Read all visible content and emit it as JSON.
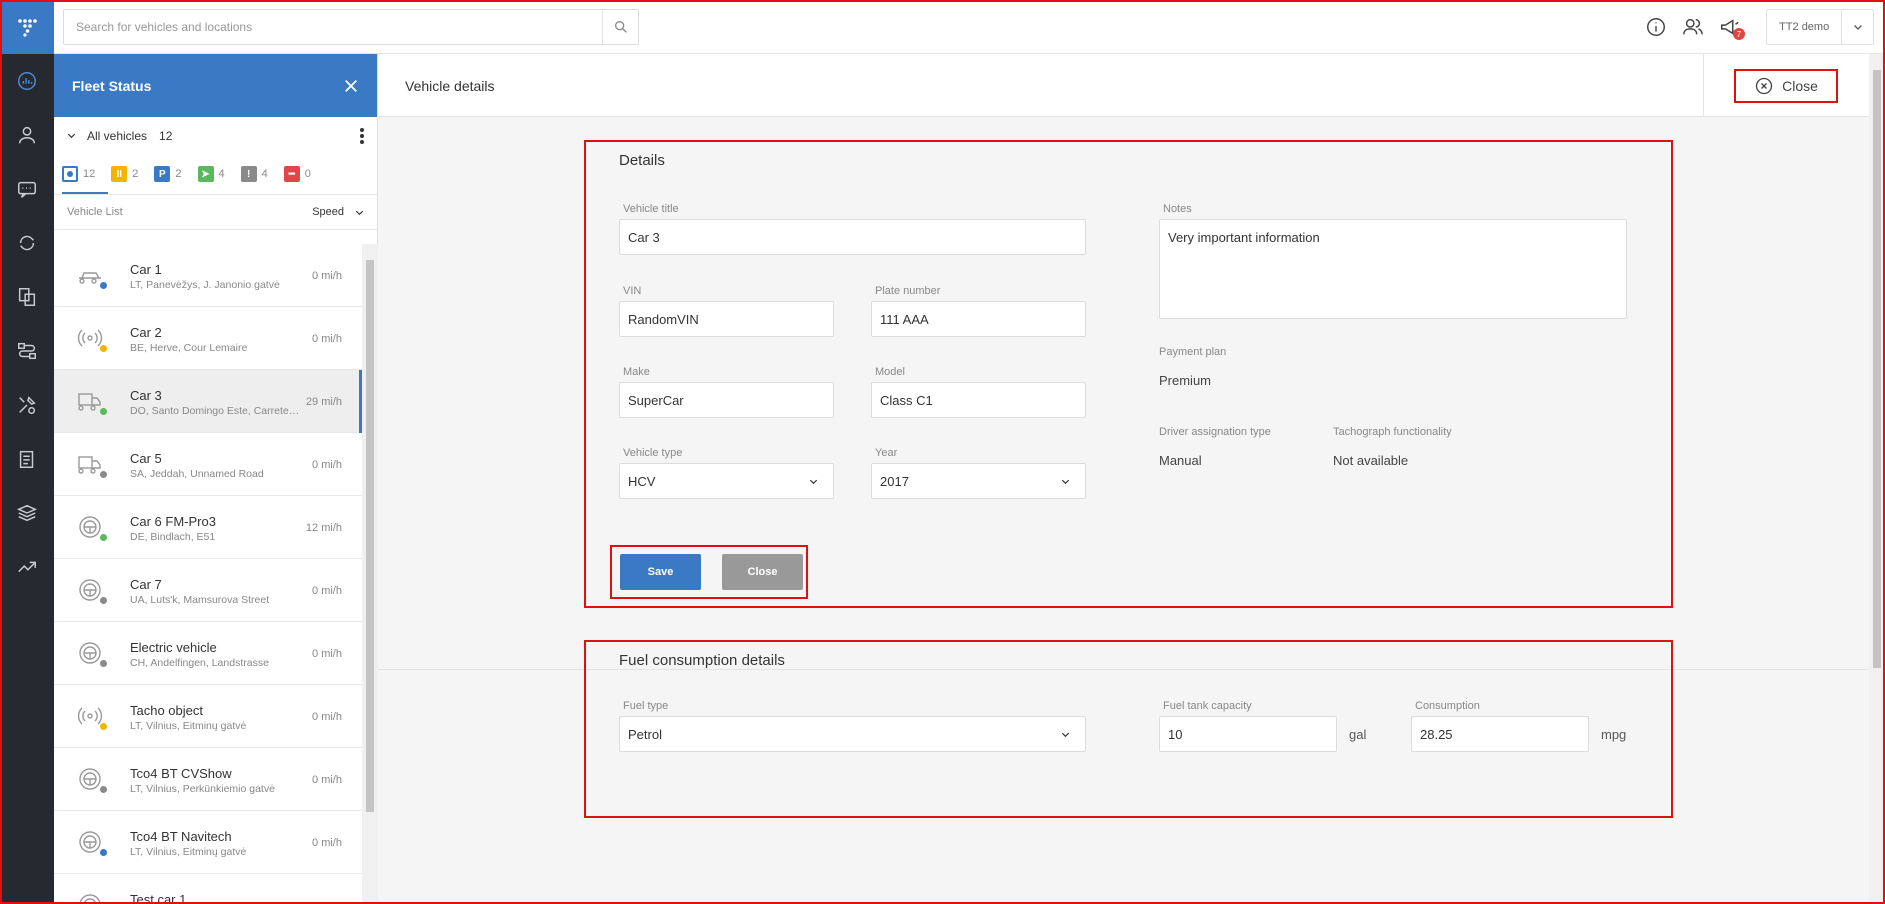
{
  "search": {
    "placeholder": "Search for vehicles and locations"
  },
  "header": {
    "account_name": "TT2 demo",
    "notification_count": "7"
  },
  "rail": {
    "items": [
      "dashboard",
      "drivers",
      "messages",
      "routes",
      "reports",
      "tasks",
      "maintenance",
      "documents",
      "layers",
      "analytics"
    ]
  },
  "fleet": {
    "title": "Fleet Status",
    "group_label": "All vehicles",
    "group_count": "12",
    "status_filters": [
      {
        "icon": "all-status",
        "count": "12",
        "color": "#3a79c4"
      },
      {
        "icon": "paused-status",
        "count": "2",
        "color": "#f5b400"
      },
      {
        "icon": "parked-status",
        "count": "2",
        "color": "#3a79c4"
      },
      {
        "icon": "moving-status",
        "count": "4",
        "color": "#5cb85c"
      },
      {
        "icon": "alert-status",
        "count": "4",
        "color": "#8a8a8a"
      },
      {
        "icon": "stopped-status",
        "count": "0",
        "color": "#e04646"
      }
    ],
    "list_label": "Vehicle List",
    "sort_label": "Speed",
    "vehicles": [
      {
        "name": "Car 1",
        "address": "LT, Panevėžys, J. Janonio gatvė",
        "speed": "0 mi/h",
        "icon": "car",
        "dot": "#3a79c4"
      },
      {
        "name": "Car 2",
        "address": "BE, Herve, Cour Lemaire",
        "speed": "0 mi/h",
        "icon": "signal",
        "dot": "#f5b400"
      },
      {
        "name": "Car 3",
        "address": "DO, Santo Domingo Este, Carretera Mella",
        "speed": "29 mi/h",
        "icon": "truck",
        "dot": "#5cb85c"
      },
      {
        "name": "Car 5",
        "address": "SA, Jeddah, Unnamed Road",
        "speed": "0 mi/h",
        "icon": "truck",
        "dot": "#8a8a8a"
      },
      {
        "name": "Car 6 FM-Pro3",
        "address": "DE, Bindlach, E51",
        "speed": "12 mi/h",
        "icon": "wheel",
        "dot": "#5cb85c"
      },
      {
        "name": "Car 7",
        "address": "UA, Luts'k, Mamsurova Street",
        "speed": "0 mi/h",
        "icon": "wheel",
        "dot": "#8a8a8a"
      },
      {
        "name": "Electric vehicle",
        "address": "CH, Andelfingen, Landstrasse",
        "speed": "0 mi/h",
        "icon": "wheel",
        "dot": "#8a8a8a"
      },
      {
        "name": "Tacho object",
        "address": "LT, Vilnius, Eitminų gatvė",
        "speed": "0 mi/h",
        "icon": "signal",
        "dot": "#f5b400"
      },
      {
        "name": "Tco4 BT CVShow",
        "address": "LT, Vilnius, Perkūnkiemio gatvė",
        "speed": "0 mi/h",
        "icon": "wheel",
        "dot": "#8a8a8a"
      },
      {
        "name": "Tco4 BT Navitech",
        "address": "LT, Vilnius, Eitminų gatvė",
        "speed": "0 mi/h",
        "icon": "wheel",
        "dot": "#3a79c4"
      },
      {
        "name": "Test car 1",
        "address": "",
        "speed": "",
        "icon": "wheel",
        "dot": "#8a8a8a"
      }
    ]
  },
  "details_page": {
    "title": "Vehicle details",
    "close_label": "Close",
    "details": {
      "title": "Details",
      "vehicle_title_label": "Vehicle title",
      "vehicle_title_value": "Car 3",
      "vin_label": "VIN",
      "vin_value": "RandomVIN",
      "plate_label": "Plate number",
      "plate_value": "111 AAA",
      "make_label": "Make",
      "make_value": "SuperCar",
      "model_label": "Model",
      "model_value": "Class C1",
      "vehicle_type_label": "Vehicle type",
      "vehicle_type_value": "HCV",
      "year_label": "Year",
      "year_value": "2017",
      "notes_label": "Notes",
      "notes_value": "Very important information",
      "payment_plan_label": "Payment plan",
      "payment_plan_value": "Premium",
      "driver_assignation_label": "Driver assignation type",
      "driver_assignation_value": "Manual",
      "tachograph_label": "Tachograph functionality",
      "tachograph_value": "Not available",
      "save_label": "Save",
      "close_label": "Close"
    },
    "fuel": {
      "title": "Fuel consumption details",
      "fuel_type_label": "Fuel type",
      "fuel_type_value": "Petrol",
      "tank_label": "Fuel tank capacity",
      "tank_value": "10",
      "tank_unit": "gal",
      "consumption_label": "Consumption",
      "consumption_value": "28.25",
      "consumption_unit": "mpg"
    }
  }
}
